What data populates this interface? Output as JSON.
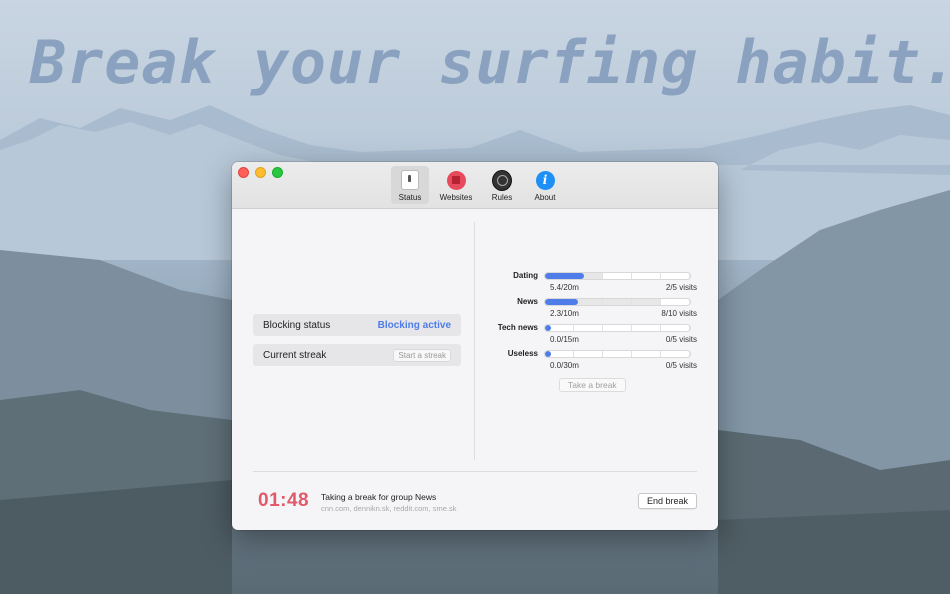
{
  "headline": "Break your surfing habit.",
  "toolbar": {
    "items": [
      {
        "label": "Status",
        "icon": "status-icon"
      },
      {
        "label": "Websites",
        "icon": "websites-icon"
      },
      {
        "label": "Rules",
        "icon": "rules-icon"
      },
      {
        "label": "About",
        "icon": "about-icon"
      }
    ]
  },
  "status": {
    "blocking_label": "Blocking status",
    "blocking_value": "Blocking active",
    "streak_label": "Current streak",
    "streak_button": "Start a streak"
  },
  "groups": [
    {
      "name": "Dating",
      "time": "5.4/20m",
      "visits": "2/5 visits",
      "time_fraction": 0.27,
      "visit_fraction": 0.4
    },
    {
      "name": "News",
      "time": "2.3/10m",
      "visits": "8/10 visits",
      "time_fraction": 0.23,
      "visit_fraction": 0.8
    },
    {
      "name": "Tech news",
      "time": "0.0/15m",
      "visits": "0/5 visits",
      "time_fraction": 0.0,
      "visit_fraction": 0.0
    },
    {
      "name": "Useless",
      "time": "0.0/30m",
      "visits": "0/5 visits",
      "time_fraction": 0.0,
      "visit_fraction": 0.0
    }
  ],
  "take_break_label": "Take a break",
  "break": {
    "timer": "01:48",
    "title": "Taking a break for group News",
    "sites": "cnn.com, dennikn.sk, reddit.com, sme.sk",
    "end_label": "End break"
  },
  "colors": {
    "accent": "#4e7ce8",
    "timer": "#e05a6a"
  }
}
